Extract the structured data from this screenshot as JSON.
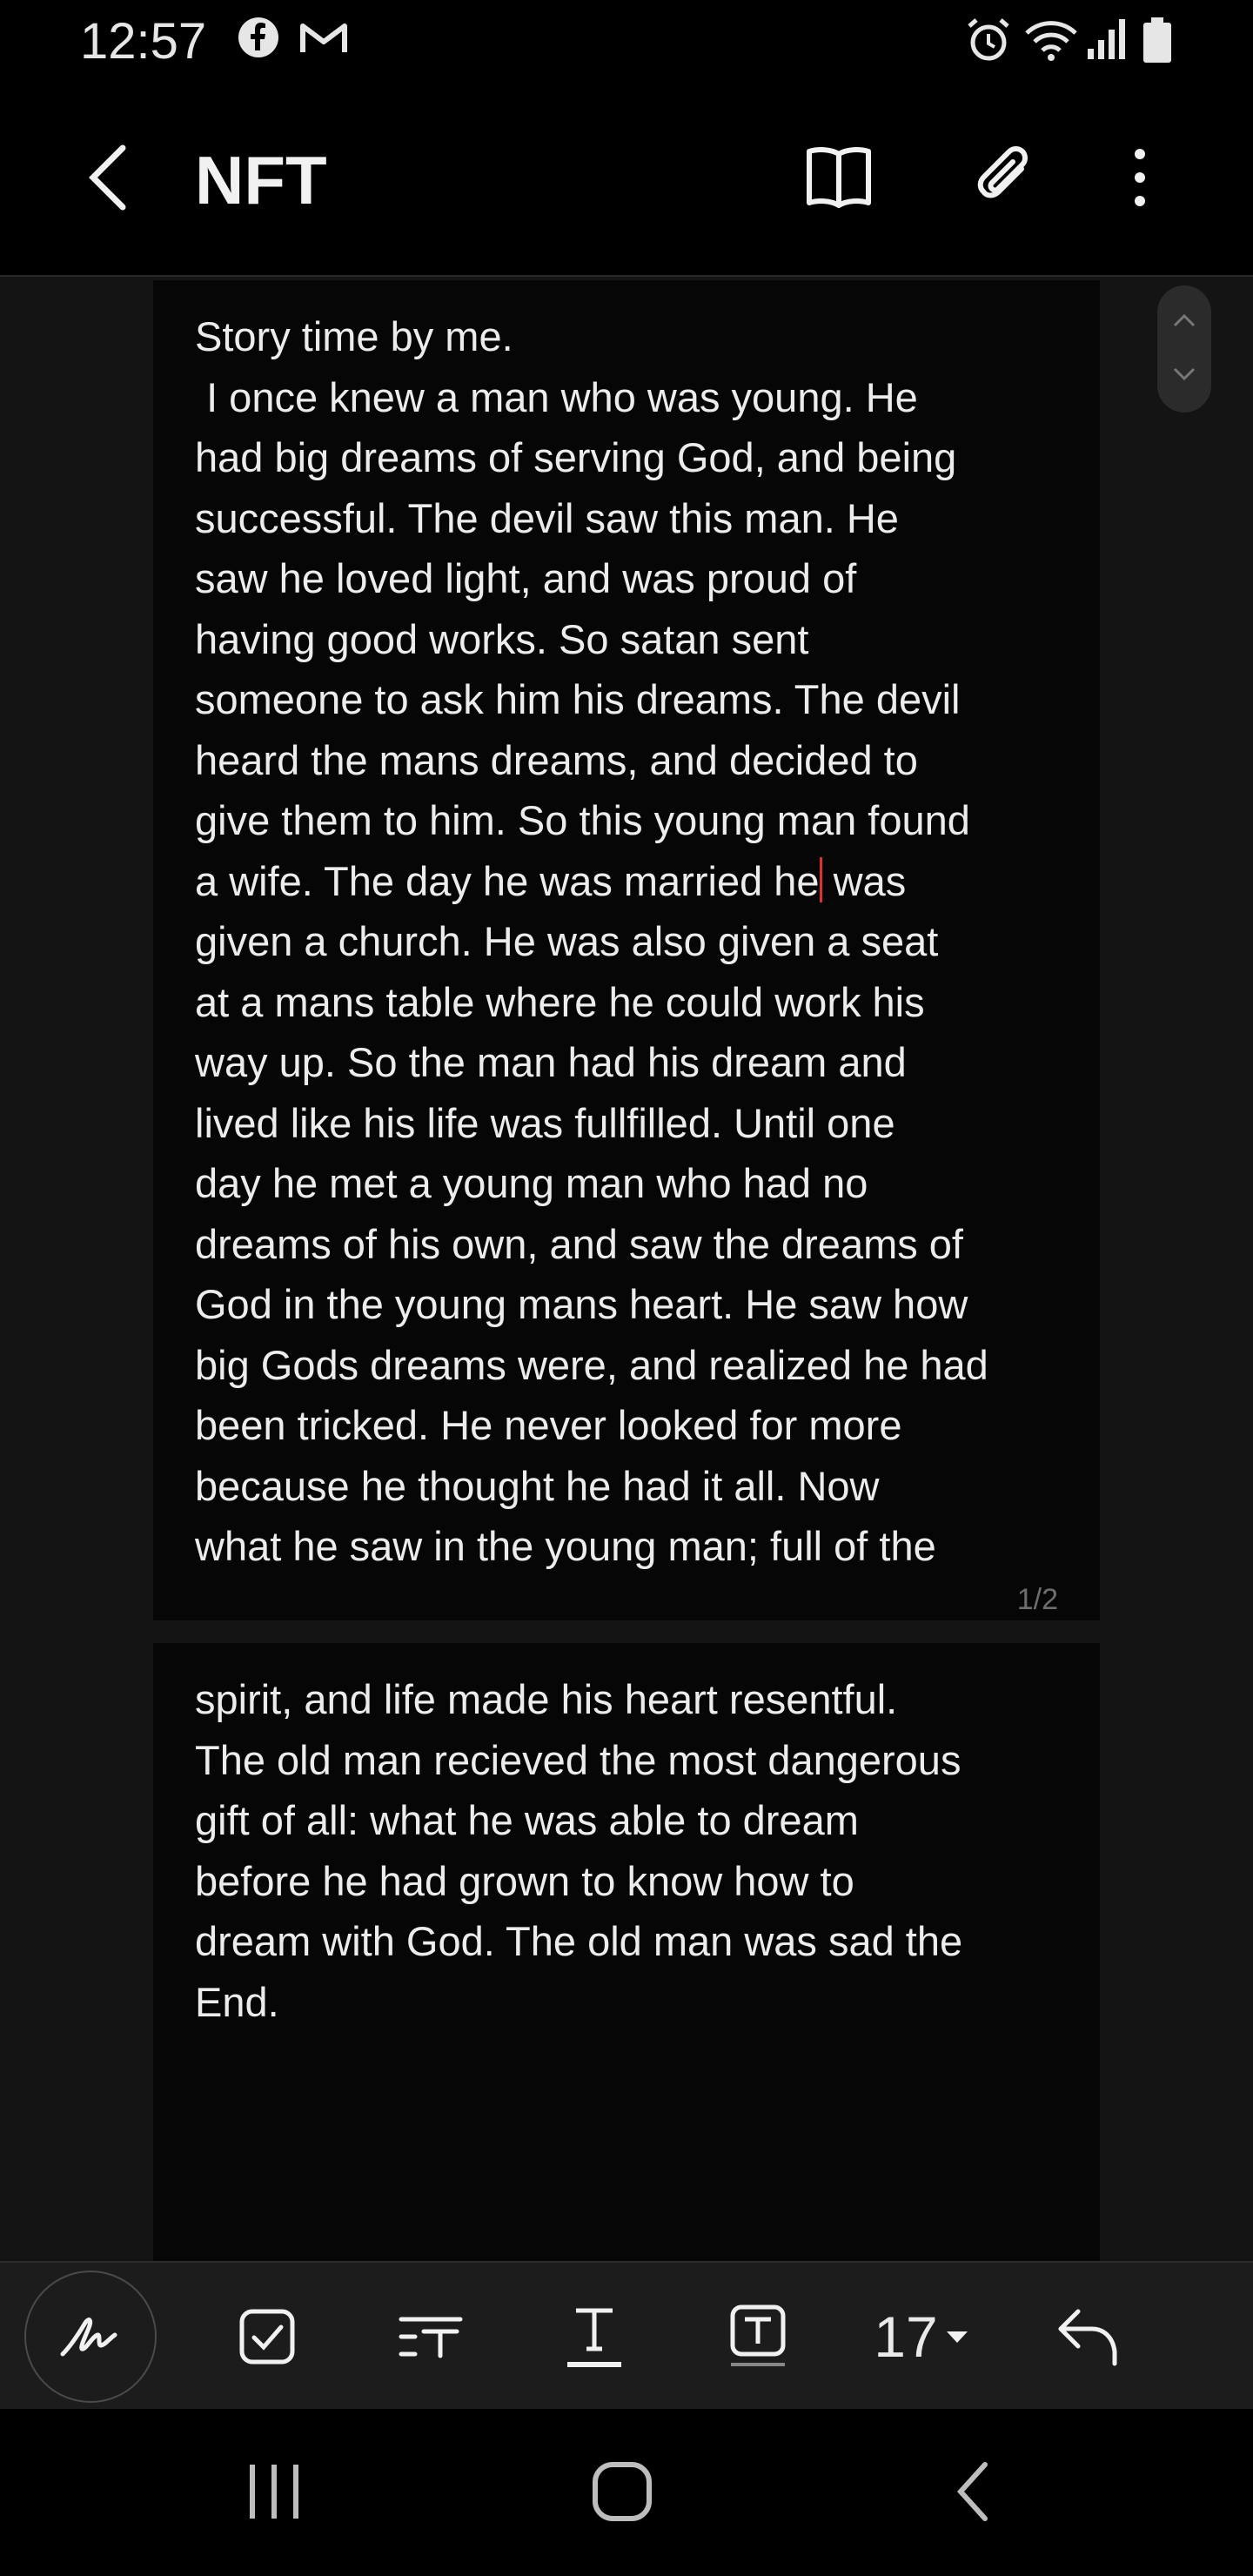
{
  "status_bar": {
    "time": "12:57",
    "left_icons": [
      "facebook-icon",
      "gmail-icon"
    ],
    "right_icons": [
      "alarm-icon",
      "wifi-icon",
      "signal-icon",
      "battery-icon"
    ]
  },
  "app_bar": {
    "title": "NFT",
    "actions": [
      "book-view-icon",
      "attachment-icon",
      "more-options-icon"
    ]
  },
  "note": {
    "page1_before_cursor": "Story time by me.\n I once knew a man who was young. He\nhad big dreams of serving God, and being\nsuccessful. The devil saw this man. He\nsaw he loved light, and was proud of\nhaving good works. So satan sent\nsomeone to ask him his dreams. The devil\nheard the mans dreams, and decided to\ngive them to him. So this young man found\na wife. The day he was married he",
    "page1_after_cursor": " was\ngiven a church. He was also given a seat\nat a mans table where he could work his\nway up. So the man had his dream and\nlived like his life was fullfilled. Until one\nday he met a young man who had no\ndreams of his own, and saw the dreams of\nGod in the young mans heart. He saw how\nbig Gods dreams were, and realized he had\nbeen tricked. He never looked for more\nbecause he thought he had it all. Now\nwhat he saw in the young man; full of the",
    "page1_number": "1/2",
    "page2_text": "spirit, and life made his heart resentful.\nThe old man recieved the most dangerous\ngift of all: what he was able to dream\nbefore he had grown to know how to\ndream with God. The old man was sad the\nEnd.",
    "cursor_color": "#e0302c"
  },
  "toolbar": {
    "tools": [
      "handwriting-pen-icon",
      "checkbox-icon",
      "paragraph-style-icon",
      "text-underline-icon",
      "text-box-icon"
    ],
    "font_size": "17",
    "undo": "undo-icon"
  },
  "nav_bar": {
    "buttons": [
      "recent-apps-icon",
      "home-icon",
      "back-nav-icon"
    ]
  }
}
